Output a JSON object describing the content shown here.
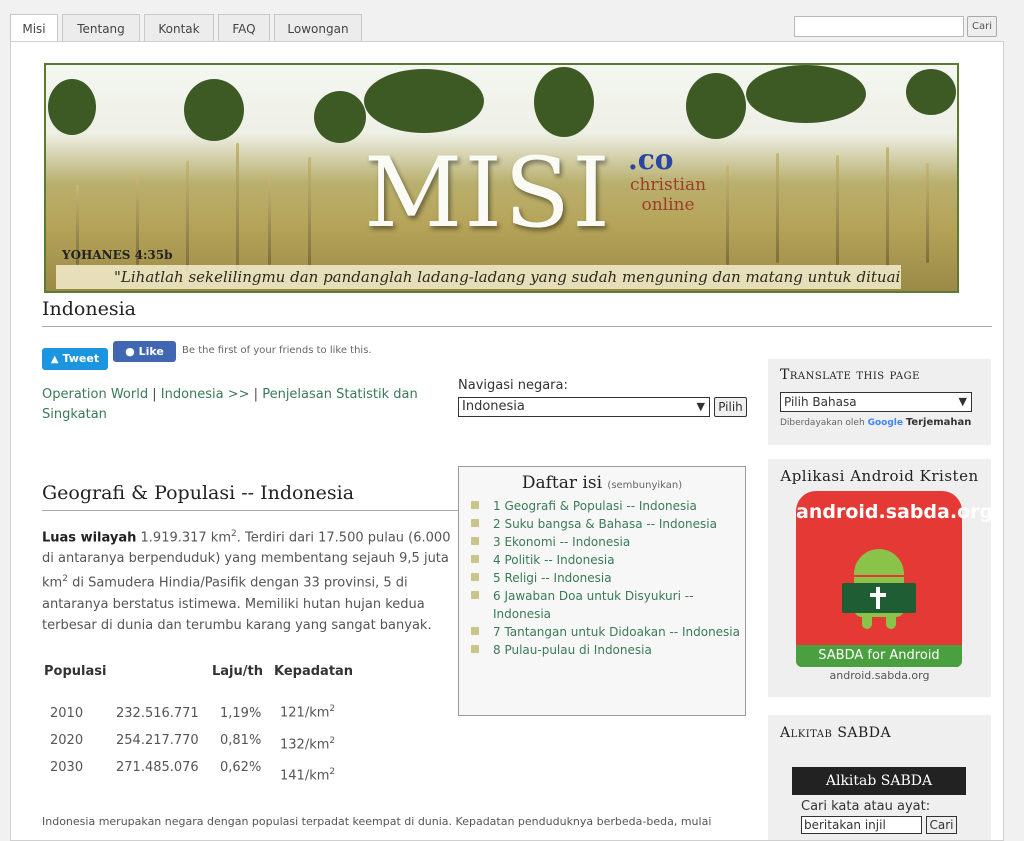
{
  "tabs": [
    "Misi",
    "Tentang",
    "Kontak",
    "FAQ",
    "Lowongan"
  ],
  "search": {
    "button_label": "Cari",
    "value": ""
  },
  "banner": {
    "logo_main": "MISI",
    "logo_co": ".co",
    "logo_sub1": "christian",
    "logo_sub2": "online",
    "verse_ref": "YOHANES 4:35b",
    "quote": "\"Lihatlah sekelilingmu dan pandanglah ladang-ladang yang sudah menguning dan matang untuk dituai.\""
  },
  "page_title": "Indonesia",
  "social": {
    "tweet_label": "Tweet",
    "like_label": "Like",
    "like_text": "Be the first of your friends to like this."
  },
  "breadcrumb": {
    "link1": "Operation World",
    "sep1": " | ",
    "link2": "Indonesia >>",
    "sep2": " | ",
    "link3": "Penjelasan Statistik dan Singkatan"
  },
  "country_nav": {
    "label": "Navigasi negara:",
    "selected": "Indonesia",
    "button_label": "Pilih"
  },
  "section_title": "Geografi & Populasi -- Indonesia",
  "area": {
    "label": "Luas wilayah",
    "value": "1.919.317 km",
    "sup": "2",
    "text1": ". Terdiri dari 17.500 pulau (6.000 di antaranya berpenduduk) yang membentang sejauh 9,5 juta km",
    "sup2": "2",
    "text2": " di Samudera Hindia/Pasifik dengan 33 provinsi, 5 di antaranya berstatus istimewa. Memiliki hutan hujan kedua terbesar di dunia dan terumbu karang yang sangat banyak."
  },
  "toc": {
    "title": "Daftar isi",
    "hide_label": "(sembunyikan)",
    "items": [
      "1 Geografi & Populasi -- Indonesia",
      "2 Suku bangsa & Bahasa -- Indonesia",
      "3 Ekonomi -- Indonesia",
      "4 Politik -- Indonesia",
      "5 Religi -- Indonesia",
      "6 Jawaban Doa untuk Disyukuri -- Indonesia",
      "7 Tantangan untuk Didoakan -- Indonesia",
      "8 Pulau-pulau di Indonesia"
    ]
  },
  "stats": {
    "headers": [
      "Populasi",
      "Laju/th",
      "Kepadatan"
    ],
    "density_unit": "/km",
    "density_sup": "2",
    "rows": [
      {
        "year": "2010",
        "pop": "232.516.771",
        "rate": "1,19%",
        "density": "121"
      },
      {
        "year": "2020",
        "pop": "254.217.770",
        "rate": "0,81%",
        "density": "132"
      },
      {
        "year": "2030",
        "pop": "271.485.076",
        "rate": "0,62%",
        "density": "141"
      }
    ]
  },
  "footer_text": "Indonesia merupakan negara dengan populasi terpadat keempat di dunia. Kepadatan penduduknya berbeda-beda, mulai",
  "sidebar": {
    "translate": {
      "title": "Translate this page",
      "selected": "Pilih Bahasa",
      "powered_prefix": "Diberdayakan oleh",
      "powered_google": "Google",
      "powered_suffix": "Terjemahan"
    },
    "android": {
      "title": "Aplikasi Android Kristen",
      "badge_text": "android.sabda.org",
      "footer": "SABDA for Android",
      "url": "android.sabda.org"
    },
    "alkitab": {
      "title": "Alkitab SABDA",
      "logo": "Alkitab SABDA",
      "label": "Cari kata atau ayat:",
      "value": "beritakan injil",
      "button_label": "Cari"
    }
  },
  "colors": {
    "link": "#3a7a57",
    "tweet": "#1b95e0",
    "like": "#4267b2",
    "android_red": "#e53935",
    "android_green": "#4aa03f"
  }
}
